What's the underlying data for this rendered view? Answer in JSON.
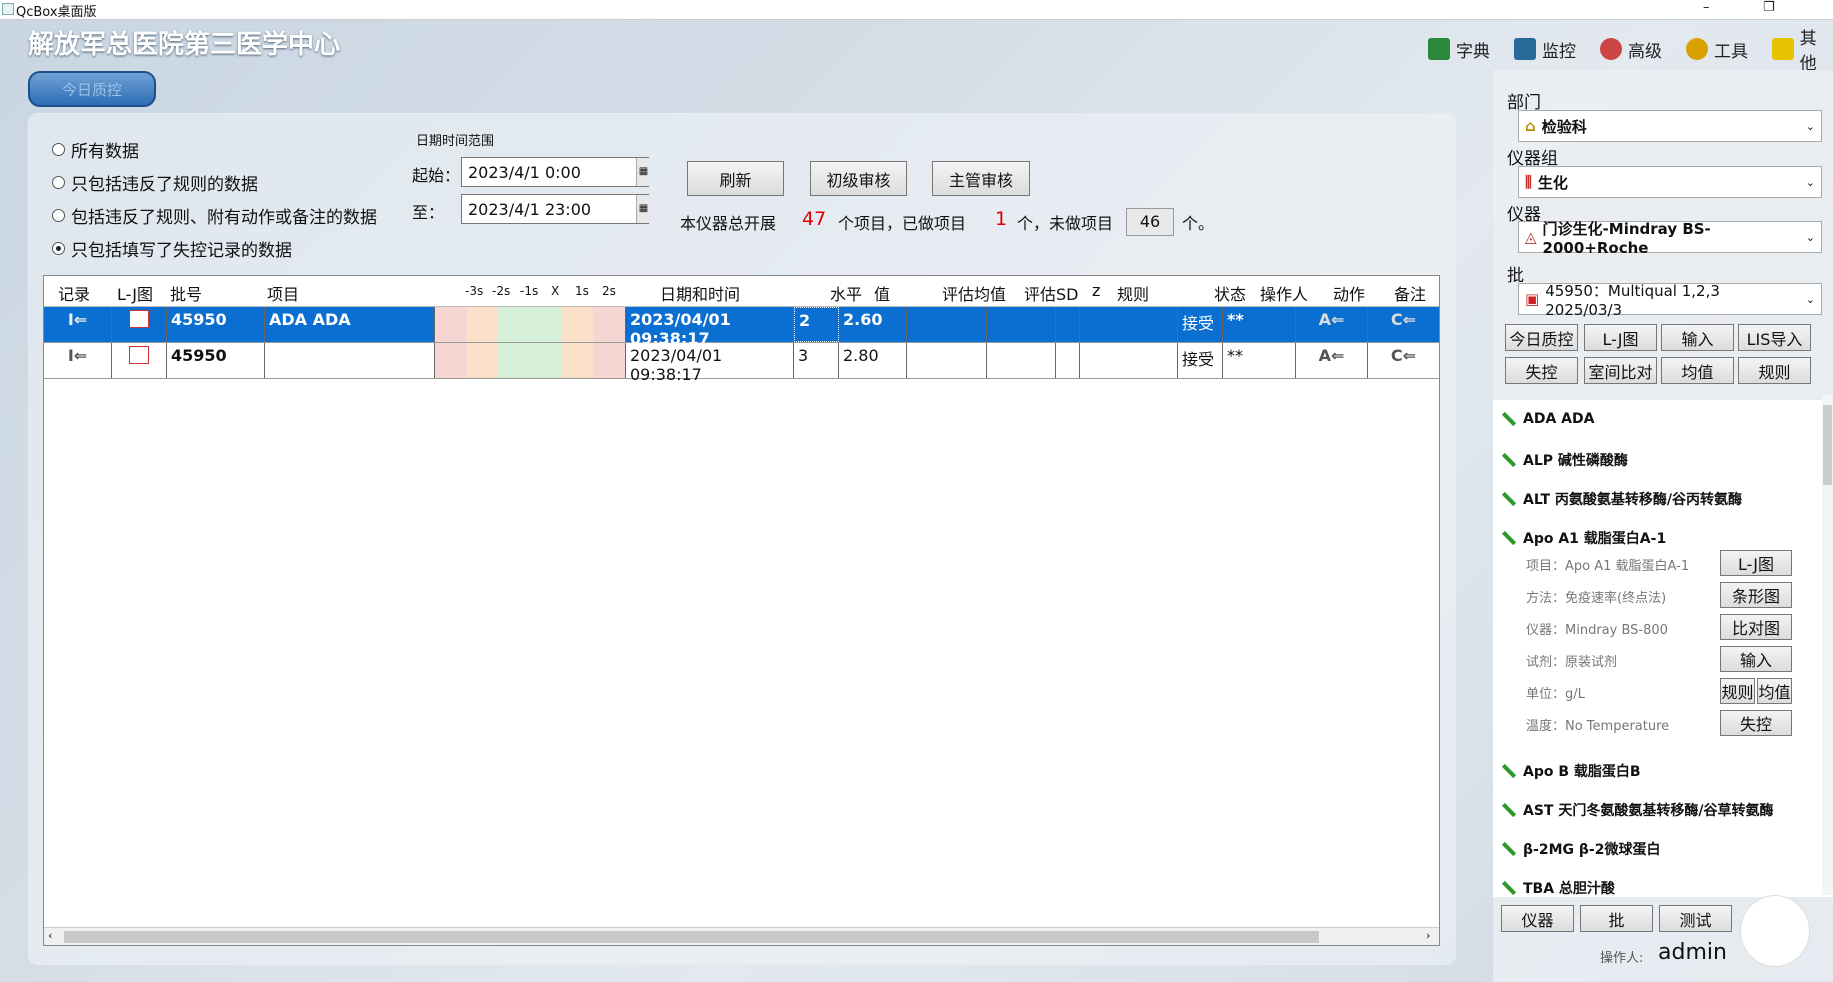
{
  "window": {
    "title": "QcBox桌面版",
    "min": "–",
    "max": "❐"
  },
  "hospital": "解放军总医院第三医学中心",
  "toolbar": [
    "字典",
    "监控",
    "高级",
    "工具",
    "其他"
  ],
  "today_btn": "今日质控",
  "filters": {
    "options": [
      "所有数据",
      "只包括违反了规则的数据",
      "包括违反了规则、附有动作或备注的数据",
      "只包括填写了失控记录的数据"
    ],
    "selected": 3
  },
  "daterange": {
    "label": "日期时间范围",
    "start_label": "起始：",
    "start": "2023/4/1 0:00",
    "end_label": "至：",
    "end": "2023/4/1 23:00"
  },
  "buttons": {
    "refresh": "刷新",
    "primary_review": "初级审核",
    "chief_review": "主管审核"
  },
  "stats": {
    "prefix": "本仪器总开展",
    "total": "47",
    "mid": "个项目，已做项目",
    "done": "1",
    "mid2": "个，未做项目",
    "undone": "46",
    "suffix": "个。"
  },
  "table": {
    "headers": {
      "record": "记录",
      "lj": "L-J图",
      "lot": "批号",
      "item": "项目",
      "scale": [
        "-3s",
        "-2s",
        "-1s",
        "X",
        "1s",
        "2s"
      ],
      "datetime": "日期和时间",
      "level": "水平",
      "value": "值",
      "eval_mean": "评估均值",
      "eval_sd": "评估SD",
      "z": "z",
      "rule": "规则",
      "status": "状态",
      "operator": "操作人",
      "action": "动作",
      "note": "备注"
    },
    "rows": [
      {
        "lot": "45950",
        "item": "ADA ADA",
        "datetime": "2023/04/01 09:38:17",
        "level": "2",
        "value": "2.60",
        "eval_mean": "",
        "eval_sd": "",
        "z": "",
        "rule": "",
        "status": "接受",
        "operator": "**"
      },
      {
        "lot": "45950",
        "item": "",
        "datetime": "2023/04/01 09:38:17",
        "level": "3",
        "value": "2.80",
        "eval_mean": "",
        "eval_sd": "",
        "z": "",
        "rule": "",
        "status": "接受",
        "operator": "**"
      }
    ]
  },
  "right": {
    "dept_label": "部门",
    "dept": "检验科",
    "group_label": "仪器组",
    "group": "生化",
    "instr_label": "仪器",
    "instr": "门诊生化-Mindray BS-2000+Roche",
    "lot_label": "批",
    "lot": "45950：Multiqual 1,2,3  2025/03/3",
    "btns1": [
      "今日质控",
      "L-J图",
      "输入",
      "LIS导入"
    ],
    "btns2": [
      "失控",
      "室间比对",
      "均值",
      "规则"
    ],
    "items": [
      "ADA ADA",
      "ALP 碱性磷酸酶",
      "ALT 丙氨酸氨基转移酶/谷丙转氨酶",
      "Apo A1 载脂蛋白A-1",
      "Apo B 载脂蛋白B",
      "AST 天门冬氨酸氨基转移酶/谷草转氨酶",
      "β-2MG β-2微球蛋白",
      "TBA 总胆汁酸"
    ],
    "detail": [
      "项目：Apo A1 载脂蛋白A-1",
      "方法：免疫速率(终点法)",
      "仪器：Mindray BS-800",
      "试剂：原装试剂",
      "单位：g/L",
      "温度：No Temperature"
    ],
    "detail_btns": [
      "L-J图",
      "条形图",
      "比对图",
      "输入",
      "规则",
      "均值",
      "失控"
    ],
    "bottom_btns": [
      "仪器",
      "批",
      "测试"
    ],
    "operator_label": "操作人:",
    "operator": "admin"
  }
}
